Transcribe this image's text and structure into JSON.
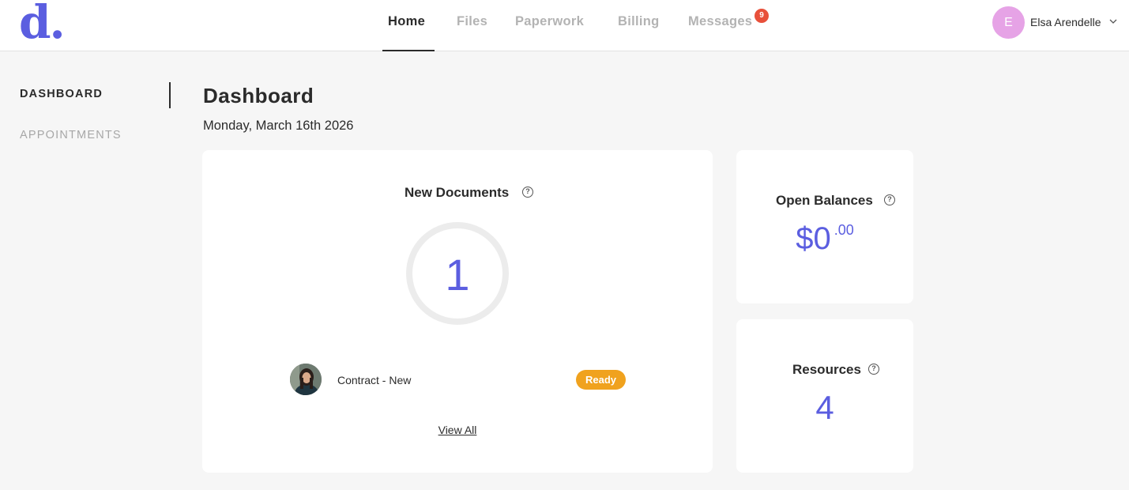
{
  "brand": {
    "logo_text": "d.",
    "accent_color": "#5b5ee0"
  },
  "nav": {
    "items": [
      {
        "label": "Home",
        "active": true
      },
      {
        "label": "Files",
        "active": false
      },
      {
        "label": "Paperwork",
        "active": false
      },
      {
        "label": "Billing",
        "active": false
      },
      {
        "label": "Messages",
        "active": false,
        "badge": "9"
      }
    ]
  },
  "user": {
    "initial": "E",
    "name": "Elsa Arendelle",
    "avatar_color": "#e6a3e6"
  },
  "sidebar": {
    "items": [
      {
        "label": "DASHBOARD",
        "active": true
      },
      {
        "label": "APPOINTMENTS",
        "active": false
      }
    ]
  },
  "page": {
    "title": "Dashboard",
    "date": "Monday, March 16th 2026"
  },
  "new_documents": {
    "title": "New Documents",
    "count": "1",
    "items": [
      {
        "name": "Contract - New",
        "status": "Ready",
        "status_color": "#f0a21e"
      }
    ],
    "view_all_label": "View All"
  },
  "open_balances": {
    "title": "Open Balances",
    "amount": "$0",
    "cents": ".00"
  },
  "resources": {
    "title": "Resources",
    "count": "4"
  }
}
